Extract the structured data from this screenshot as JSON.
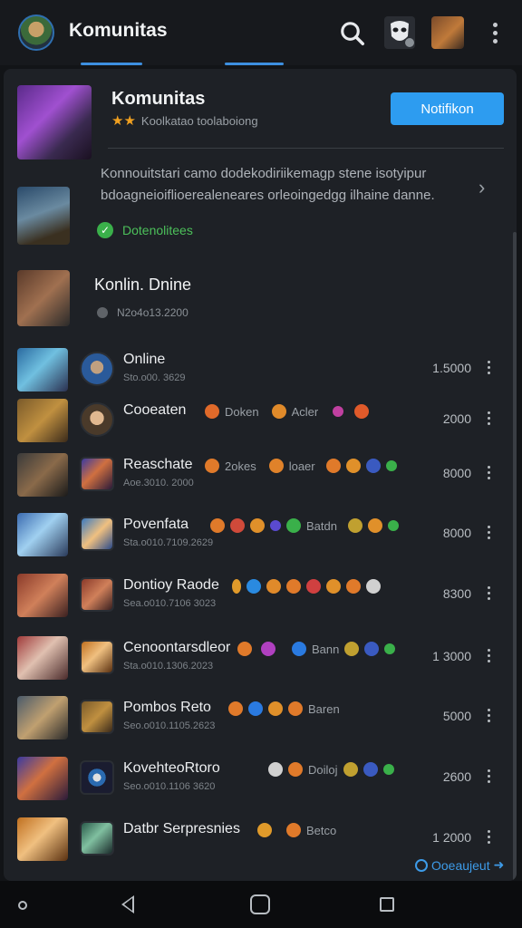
{
  "topbar": {
    "title": "Komunitas"
  },
  "header": {
    "title": "Komunitas",
    "subtitle": "Koolkatao toolaboiong",
    "notify_button": "Notifikon"
  },
  "info": {
    "description": "Konnouitstari camo dodekodiriikemagp stene isotyipur bdoagneioiflioerealeneares orleoingedgg ilhaine danne.",
    "status": "Dotenolitees"
  },
  "online": {
    "title": "Konlin. Dnine",
    "subtitle": "N2o4o13.2200"
  },
  "rows": [
    {
      "name": "Online",
      "date": "Sto.o00. 3629",
      "tags": [],
      "value": "1.5000"
    },
    {
      "name": "Cooeaten",
      "date": "",
      "tags": [
        "Doken",
        "Acler"
      ],
      "value": "2000"
    },
    {
      "name": "Reaschate",
      "date": "Aoe.3010. 2000",
      "tags": [
        "2okes",
        "loaer"
      ],
      "value": "8000"
    },
    {
      "name": "Povenfata",
      "date": "Sta.o010.7109.2629",
      "tags": [
        "Batdn"
      ],
      "value": "8000"
    },
    {
      "name": "Dontioy Raode",
      "date": "Sea.o010.7106 3023",
      "tags": [],
      "value": "8300"
    },
    {
      "name": "Cenoontarsdleor",
      "date": "Sta.o010.1306.2023",
      "tags": [
        "Bann"
      ],
      "value": "1 3000"
    },
    {
      "name": "Pombos Reto",
      "date": "Seo.o010.1105.2623",
      "tags": [
        "Baren"
      ],
      "value": "5000"
    },
    {
      "name": "KovehteoRtoro",
      "date": "Seo.o010.1106 3620",
      "tags": [
        "Doiloj"
      ],
      "value": "2600"
    },
    {
      "name": "Datbr Serpresnies",
      "date": "",
      "tags": [
        "Betco"
      ],
      "value": "1 2000"
    }
  ],
  "footer_link": "Ooeaujeut"
}
